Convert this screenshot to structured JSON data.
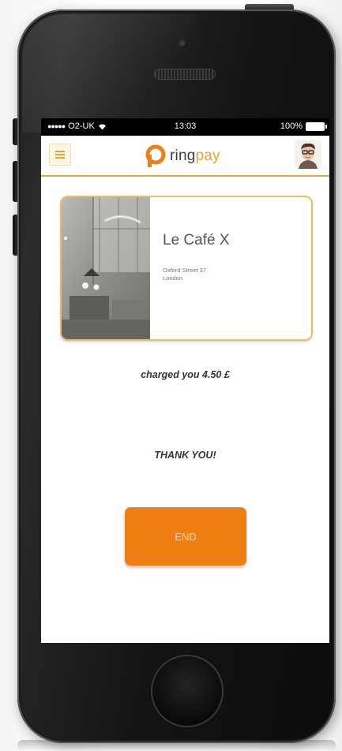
{
  "status_bar": {
    "signal": "●●●●●",
    "carrier": "O2-UK",
    "time": "13:03",
    "battery_percent": "100%"
  },
  "header": {
    "menu_icon": "menu-icon",
    "logo_text_main": "ring",
    "logo_text_accent": "pay",
    "avatar_icon": "user-avatar"
  },
  "merchant": {
    "name": "Le Café X",
    "address_line1": "Oxford Street 37",
    "address_line2": "London"
  },
  "message": {
    "charge": "charged you 4.50 £",
    "thanks": "THANK YOU!"
  },
  "end_button": {
    "label": "END"
  },
  "colors": {
    "brand_orange": "#f07f13",
    "brand_gold": "#e8a52f",
    "card_border": "#e9bb6a"
  }
}
